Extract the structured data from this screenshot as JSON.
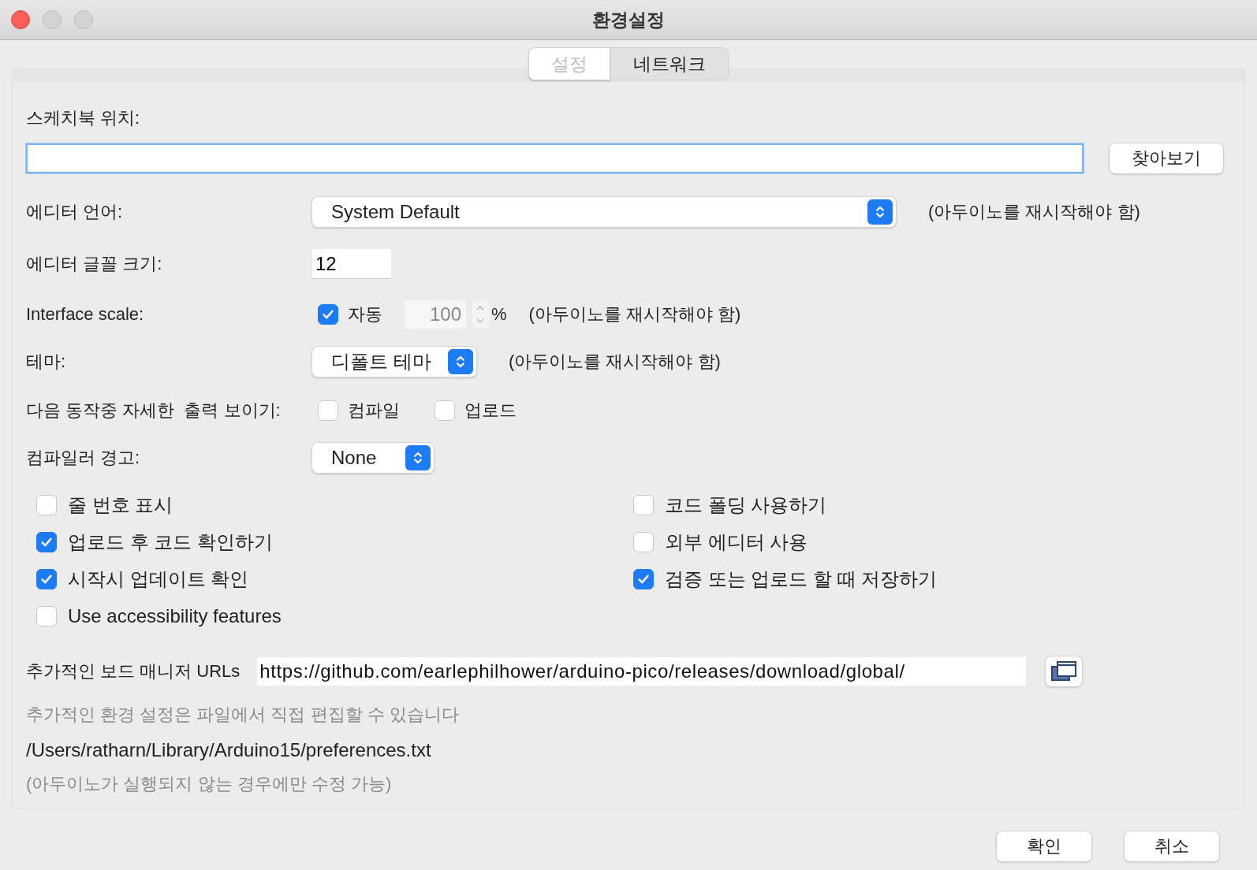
{
  "window": {
    "title": "환경설정"
  },
  "tabs": [
    {
      "label": "설정",
      "selected": true
    },
    {
      "label": "네트워크",
      "selected": false
    }
  ],
  "sketchbook": {
    "label": "스케치북 위치:",
    "browse_button": "찾아보기"
  },
  "editor_language": {
    "label": "에디터 언어:",
    "value": "System Default",
    "note": "(아두이노를 재시작해야 함)"
  },
  "font_size": {
    "label": "에디터 글꼴 크기:",
    "value": "12"
  },
  "interface_scale": {
    "label": "Interface scale:",
    "auto_label": "자동",
    "auto_checked": true,
    "value": "100",
    "disabled": true,
    "unit": "%",
    "note": "(아두이노를 재시작해야 함)"
  },
  "theme": {
    "label": "테마:",
    "value": "디폴트 테마",
    "note": "(아두이노를 재시작해야 함)"
  },
  "verbose": {
    "label": "다음 동작중 자세한  출력 보이기:",
    "options": [
      {
        "label": "컴파일",
        "checked": false
      },
      {
        "label": "업로드",
        "checked": false
      }
    ]
  },
  "compiler_warnings": {
    "label": "컴파일러 경고:",
    "value": "None"
  },
  "options_left": [
    {
      "label": "줄 번호 표시",
      "checked": false
    },
    {
      "label": "업로드 후 코드 확인하기",
      "checked": true
    },
    {
      "label": "시작시 업데이트 확인",
      "checked": true
    },
    {
      "label": "Use accessibility features",
      "checked": false
    }
  ],
  "options_right": [
    {
      "label": "코드 폴딩 사용하기",
      "checked": false
    },
    {
      "label": "외부 에디터 사용",
      "checked": false
    },
    {
      "label": "검증 또는 업로드 할 때 저장하기",
      "checked": true
    }
  ],
  "board_urls": {
    "label": "추가적인 보드 매니저 URLs",
    "value": "https://github.com/earlephilhower/arduino-pico/releases/download/global/"
  },
  "more_prefs_note": "추가적인 환경 설정은 파일에서 직접 편집할 수 있습니다",
  "prefs_path": "/Users/ratharn/Library/Arduino15/preferences.txt",
  "edit_note": "(아두이노가 실행되지 않는 경우에만 수정 가능)",
  "buttons": [
    {
      "label": "확인"
    },
    {
      "label": "취소"
    }
  ]
}
